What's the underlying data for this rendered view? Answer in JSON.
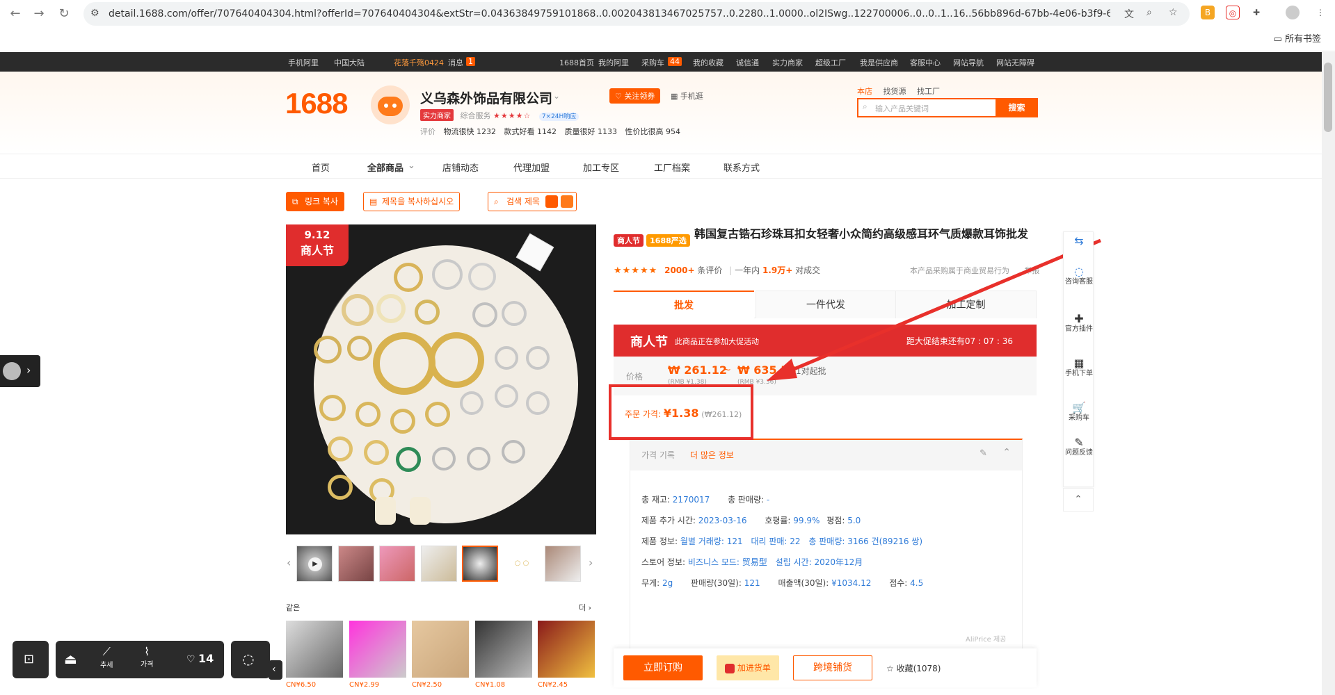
{
  "browser": {
    "url": "detail.1688.com/offer/707640404304.html?offerId=707640404304&extStr=0.04363849759101868..0.002043813467025757..0.2280..1.0000..ol2ISwg..122700006..0..0..1..16..56bb896d-67bb-4e06-b3f9-681e1698261c....",
    "bookmarks_label": "所有书签"
  },
  "topbar": {
    "items": [
      "手机阿里",
      "中国大陆",
      "花落千殇0424",
      "消息",
      "1688首页",
      "我的阿里",
      "采购车",
      "我的收藏",
      "诚信通",
      "实力商家",
      "超级工厂",
      "我是供应商",
      "客服中心",
      "网站导航",
      "网站无障碍"
    ],
    "msg_count": "1",
    "cart_count": "44"
  },
  "shop": {
    "logo": "1688",
    "name": "义乌森外饰品有限公司",
    "tag": "实力商家",
    "service_label": "综合服务",
    "stars": "★★★★☆",
    "badge": "7×24H响应",
    "follow": "关注领券",
    "mobile": "手机逛",
    "reviews_label": "评价",
    "reviews": [
      "物流很快 1232",
      "款式好看 1142",
      "质量很好 1133",
      "性价比很高 954"
    ]
  },
  "search": {
    "tabs": [
      "本店",
      "找货源",
      "找工厂"
    ],
    "placeholder": "输入产品关键词",
    "button": "搜索"
  },
  "nav": [
    "首页",
    "全部商品",
    "店铺动态",
    "代理加盟",
    "加工专区",
    "工厂档案",
    "联系方式"
  ],
  "tools": {
    "copy_link": "링크 복사",
    "copy_title": "제목을 복사하십시오",
    "search_title": "검색 제목"
  },
  "promo_image": {
    "date": "9.12",
    "label": "商人节"
  },
  "same": {
    "label": "같은",
    "more": "더",
    "prices": [
      "CN¥6.50",
      "CN¥2.99",
      "CN¥2.50",
      "CN¥1.08",
      "CN¥2.45"
    ]
  },
  "product": {
    "badge1": "商人节",
    "badge2": "1688严选",
    "title": "韩国复古锆石珍珠耳扣女轻奢小众简约高级感耳环气质爆款耳饰批发",
    "rating_stars": "★★★★★",
    "review_count": "2000+",
    "review_suffix": "条评价",
    "sales_prefix": "一年内",
    "sales_count": "1.9万+",
    "sales_suffix": "对成交",
    "note": "本产品采购属于商业贸易行为",
    "report": "举报"
  },
  "tabs": [
    "批发",
    "一件代发",
    "加工定制"
  ],
  "promobar": {
    "title": "商人节",
    "text": "此商品正在参加大促活动",
    "countdown": "距大促结束还有07 : 07 : 36"
  },
  "price": {
    "label": "价格",
    "low": "₩ 261.12",
    "high": "₩ 635.73",
    "low_rmb": "(RMB ¥1.38)",
    "high_rmb": "(RMB ¥3.36)",
    "moq": "1对起批"
  },
  "order_price": {
    "label": "주문 가격:",
    "value": "¥1.38",
    "sub": "(₩261.12)"
  },
  "history": {
    "title": "가격 기록",
    "more": "더 많은 정보",
    "rows": [
      [
        [
          "총 재고: ",
          "2170017"
        ],
        [
          "총 판매량: ",
          "-"
        ]
      ],
      [
        [
          "제품 추가 시간: ",
          "2023-03-16"
        ],
        [
          "호평률: ",
          "99.9%"
        ],
        [
          "평점: ",
          "5.0"
        ]
      ],
      [
        [
          "제품 정보: ",
          "월별 거래량: 121"
        ],
        [
          "",
          "대리 판매: 22"
        ],
        [
          "",
          "총 판매량: 3166 건(89216 쌍)"
        ]
      ],
      [
        [
          "스토어 정보: ",
          "비즈니스 모드: 贸易型"
        ],
        [
          "",
          "설립 시간: 2020年12月"
        ]
      ],
      [
        [
          "무게: ",
          "2g"
        ],
        [
          "판매량(30일): ",
          "121"
        ],
        [
          "매출액(30일): ",
          "¥1034.12"
        ],
        [
          "점수: ",
          "4.5"
        ]
      ]
    ],
    "footer": "AliPrice 제공"
  },
  "actions": {
    "buy": "立即订购",
    "cart": "加进货单",
    "cross": "跨境铺货",
    "fav": "收藏(1078)"
  },
  "right_toolbar": [
    "咨询客服",
    "官方插件",
    "手机下单",
    "采购车",
    "问题反馈"
  ],
  "dock": {
    "trend": "추세",
    "price": "가격",
    "likes": "14"
  },
  "colors": {
    "brand": "#ff5a00",
    "promo_red": "#e02d2d",
    "highlight": "#e8302b",
    "link": "#2f7bd8"
  }
}
